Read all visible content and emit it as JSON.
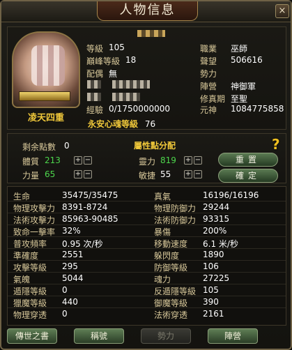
{
  "window": {
    "title": "人物信息",
    "close_label": "×"
  },
  "character": {
    "name": "凌天四重",
    "left_info": [
      {
        "label": "等級",
        "value": "105"
      },
      {
        "label": "巔峰等級",
        "value": "18"
      },
      {
        "label": "配偶",
        "value": "無"
      },
      {
        "label": "經驗",
        "value": "0/1750000000"
      }
    ],
    "right_info": [
      {
        "label": "職業",
        "value": "巫師"
      },
      {
        "label": "聲望",
        "value": "506616"
      },
      {
        "label": "勢力",
        "value": ""
      },
      {
        "label": "陣營",
        "value": "神御軍"
      },
      {
        "label": "修真期",
        "value": "至聖"
      },
      {
        "label": "元神",
        "value": "1084775858"
      }
    ],
    "soul_label": "永安心魂等級",
    "soul_value": "76"
  },
  "attributes": {
    "title": "屬性點分配",
    "help_icon": "?",
    "remaining_label": "剩余點數",
    "remaining_value": "0",
    "stats": [
      {
        "label": "體質",
        "value": "213"
      },
      {
        "label": "力量",
        "value": "65"
      },
      {
        "label": "靈力",
        "value": "819"
      },
      {
        "label": "敏捷",
        "value": "55"
      }
    ],
    "plus": "+",
    "minus": "−",
    "reset_label": "重置",
    "confirm_label": "確定"
  },
  "stats": {
    "rows": [
      {
        "l_label": "生命",
        "l_value": "35475/35475",
        "r_label": "真氣",
        "r_value": "16196/16196"
      },
      {
        "l_label": "物理攻擊力",
        "l_value": "8391-8724",
        "r_label": "物理防御力",
        "r_value": "29244"
      },
      {
        "l_label": "法術攻擊力",
        "l_value": "85963-90485",
        "r_label": "法術防御力",
        "r_value": "93315"
      },
      {
        "l_label": "致命一擊率",
        "l_value": "32%",
        "r_label": "暴傷",
        "r_value": "200%"
      },
      {
        "l_label": "普攻頻率",
        "l_value": "0.95 次/秒",
        "r_label": "移動速度",
        "r_value": "6.1 米/秒"
      },
      {
        "l_label": "準確度",
        "l_value": "2551",
        "r_label": "躲閃度",
        "r_value": "1890"
      },
      {
        "l_label": "攻擊等級",
        "l_value": "295",
        "r_label": "防御等級",
        "r_value": "106"
      },
      {
        "l_label": "氣魄",
        "l_value": "5044",
        "r_label": "魂力",
        "r_value": "27225"
      },
      {
        "l_label": "遁隱等級",
        "l_value": "0",
        "r_label": "反遁隱等級",
        "r_value": "105"
      },
      {
        "l_label": "獵魔等級",
        "l_value": "440",
        "r_label": "御魔等級",
        "r_value": "390"
      },
      {
        "l_label": "物理穿透",
        "l_value": "0",
        "r_label": "法術穿透",
        "r_value": "2161"
      }
    ]
  },
  "bottom_buttons": [
    {
      "label": "傳世之書",
      "enabled": true
    },
    {
      "label": "稱號",
      "enabled": true
    },
    {
      "label": "勢力",
      "enabled": false
    },
    {
      "label": "陣營",
      "enabled": true
    }
  ]
}
